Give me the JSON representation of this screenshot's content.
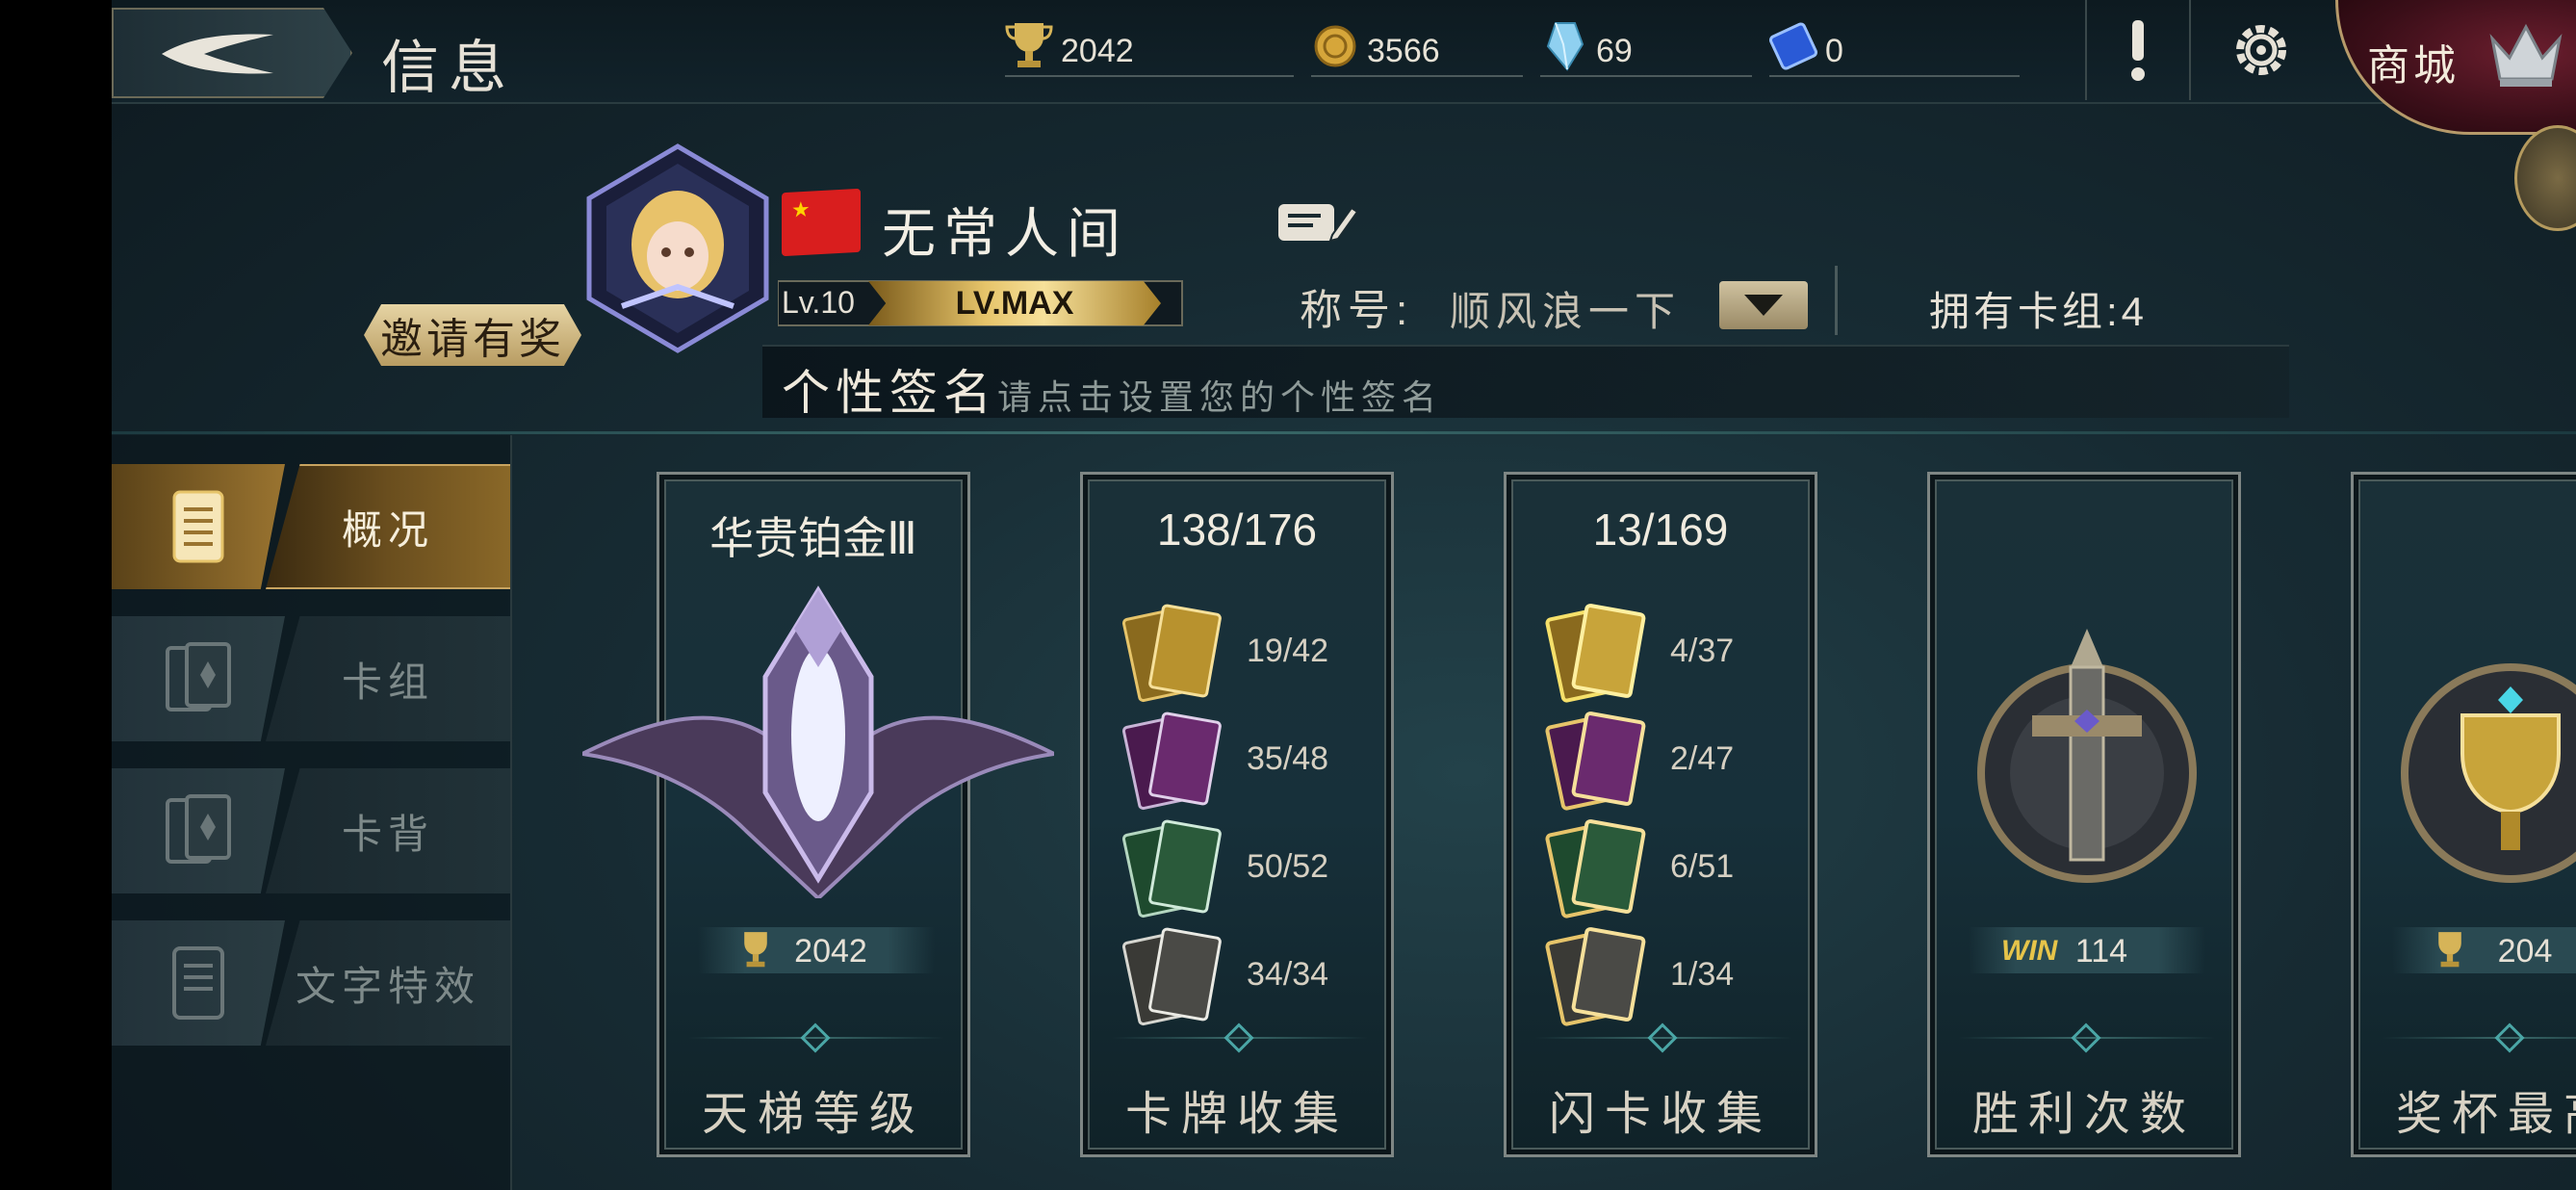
{
  "header": {
    "title": "信息",
    "resources": [
      {
        "icon": "trophy-icon",
        "value": "2042"
      },
      {
        "icon": "gold-coin-icon",
        "value": "3566"
      },
      {
        "icon": "crystal-icon",
        "value": "69"
      },
      {
        "icon": "card-pack-ticket-icon",
        "value": "0"
      }
    ],
    "shop_label": "商城"
  },
  "profile": {
    "name": "无常人间",
    "level": "Lv.10",
    "level_max": "LV.MAX",
    "invite_label": "邀请有奖",
    "title_label": "称号:",
    "title_value": "顺风浪一下",
    "deck_count": "拥有卡组:4",
    "signature_label": "个性签名",
    "signature_placeholder": "请点击设置您的个性签名"
  },
  "nav": [
    {
      "label": "概况",
      "icon": "scroll-icon",
      "active": true
    },
    {
      "label": "卡组",
      "icon": "card-deck-icon",
      "active": false
    },
    {
      "label": "卡背",
      "icon": "card-back-icon",
      "active": false
    },
    {
      "label": "文字特效",
      "icon": "text-effect-icon",
      "active": false
    }
  ],
  "cards": {
    "ladder": {
      "header": "华贵铂金Ⅲ",
      "stat": "2042",
      "footer": "天梯等级"
    },
    "card_collection": {
      "header": "138/176",
      "rows": [
        "19/42",
        "35/48",
        "50/52",
        "34/34"
      ],
      "footer": "卡牌收集"
    },
    "flash_collection": {
      "header": "13/169",
      "rows": [
        "4/37",
        "2/47",
        "6/51",
        "1/34"
      ],
      "footer": "闪卡收集"
    },
    "wins": {
      "win_tag": "WIN",
      "stat": "114",
      "footer": "胜利次数"
    },
    "trophy_high": {
      "stat": "204",
      "footer": "奖杯最高"
    }
  },
  "colors": {
    "gold": "#c8a460",
    "legendary": "#b8922e",
    "epic": "#6a2a6e",
    "rare": "#2a5a3a",
    "common": "#4a4a46",
    "accent_teal": "#4aa6a6"
  }
}
